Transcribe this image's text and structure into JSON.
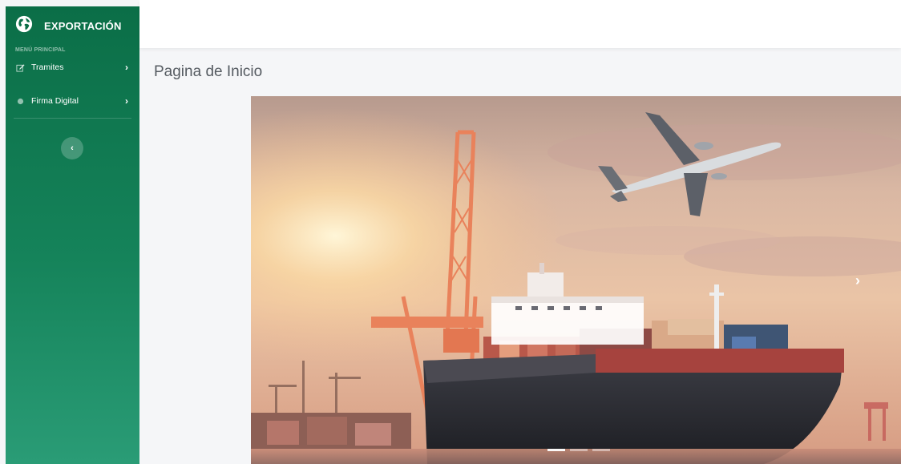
{
  "sidebar": {
    "brand_title": "EXPORTACIÓN",
    "brand_icon": "globe-icon",
    "section_label": "MENÚ PRINCIPAL",
    "items": [
      {
        "label": "Tramites",
        "icon": "edit-icon"
      },
      {
        "label": "Firma Digital",
        "icon": "dot-icon"
      }
    ],
    "collapse_icon": "chevron-left-icon",
    "chevron_glyph": "›",
    "collapse_glyph": "‹"
  },
  "main": {
    "page_title": "Pagina de Inicio"
  },
  "carousel": {
    "next_glyph": "›",
    "slide_count": 3,
    "active_index": 0
  },
  "colors": {
    "sidebar_top": "#0b6e47",
    "sidebar_bottom": "#2a9c76",
    "page_bg": "#f5f6f8"
  }
}
